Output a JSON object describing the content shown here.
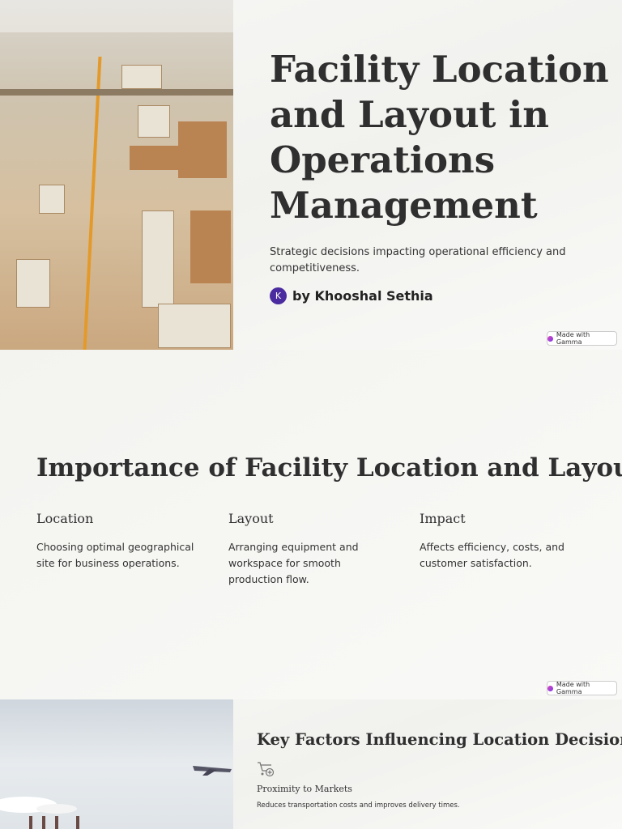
{
  "slide1": {
    "title": "Facility Location and Layout in Operations Management",
    "subtitle": "Strategic decisions impacting operational efficiency and competitiveness.",
    "avatar_initial": "K",
    "author": "by Khooshal Sethia",
    "badge": "Made with Gamma"
  },
  "slide2": {
    "title": "Importance of Facility Location and Layout",
    "columns": [
      {
        "heading": "Location",
        "text": "Choosing optimal geographical site for business operations."
      },
      {
        "heading": "Layout",
        "text": "Arranging equipment and workspace for smooth production flow."
      },
      {
        "heading": "Impact",
        "text": "Affects efficiency, costs, and customer satisfaction."
      }
    ],
    "badge": "Made with Gamma"
  },
  "slide3": {
    "title": "Key Factors Influencing Location Decisions",
    "factor": {
      "icon": "cart-plus-icon",
      "title": "Proximity to Markets",
      "text": "Reduces transportation costs and improves delivery times."
    }
  }
}
